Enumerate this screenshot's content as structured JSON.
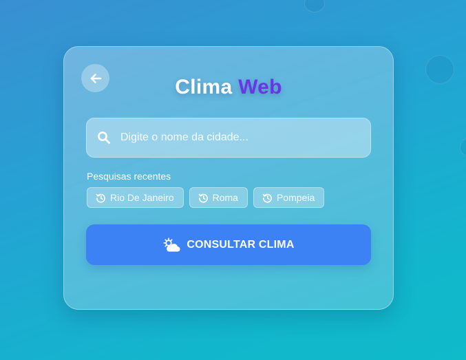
{
  "app": {
    "title_part1": "Clima",
    "title_part2": "Web"
  },
  "search": {
    "value": "",
    "placeholder": "Digite o nome da cidade..."
  },
  "recent": {
    "label": "Pesquisas recentes",
    "items": [
      {
        "label": "Rio De Janeiro"
      },
      {
        "label": "Roma"
      },
      {
        "label": "Pompeia"
      }
    ]
  },
  "actions": {
    "consult_label": "CONSULTAR CLIMA"
  },
  "icons": {
    "back": "arrow-left-icon",
    "search": "search-icon",
    "history": "history-icon",
    "weather": "sun-cloud-icon"
  },
  "colors": {
    "accent": "#3d82f5",
    "title_accent": "#6a35e6"
  }
}
